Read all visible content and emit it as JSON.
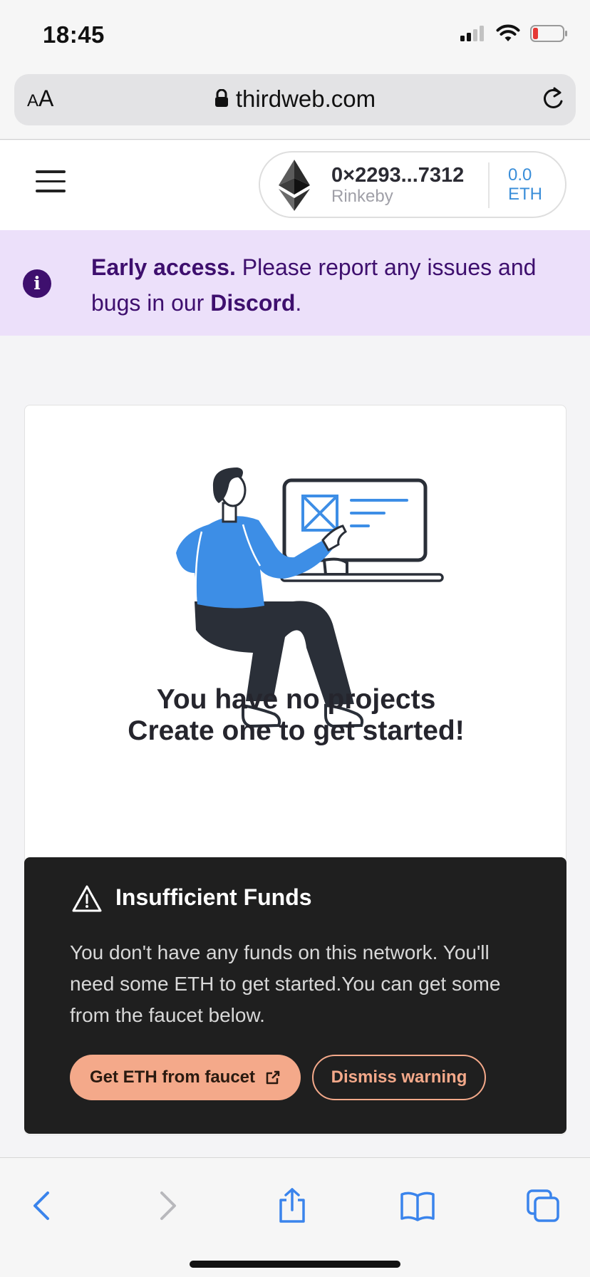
{
  "status_bar": {
    "time": "18:45"
  },
  "browser": {
    "aa_small": "A",
    "aa_large": "A",
    "url": "thirdweb.com"
  },
  "wallet": {
    "address": "0×2293...7312",
    "network": "Rinkeby",
    "balance_amount": "0.0",
    "balance_unit": "ETH"
  },
  "banner": {
    "bold": "Early access.",
    "text": " Please report any issues and bugs in our ",
    "link": "Discord",
    "end": "."
  },
  "empty_state": {
    "line1": "You have no projects",
    "line2": "Create one to get started!"
  },
  "toast": {
    "title": "Insufficient Funds",
    "body": "You don't have any funds on this network. You'll need some ETH to get started.You can get some from the faucet below.",
    "primary_button": "Get ETH from faucet",
    "secondary_button": "Dismiss warning"
  },
  "colors": {
    "accent": "#f4a98a",
    "banner_bg": "#ece0fa",
    "banner_text": "#3e0f6e",
    "eth_blue": "#3a8ed9",
    "illustration_blue": "#3d8ee6"
  }
}
